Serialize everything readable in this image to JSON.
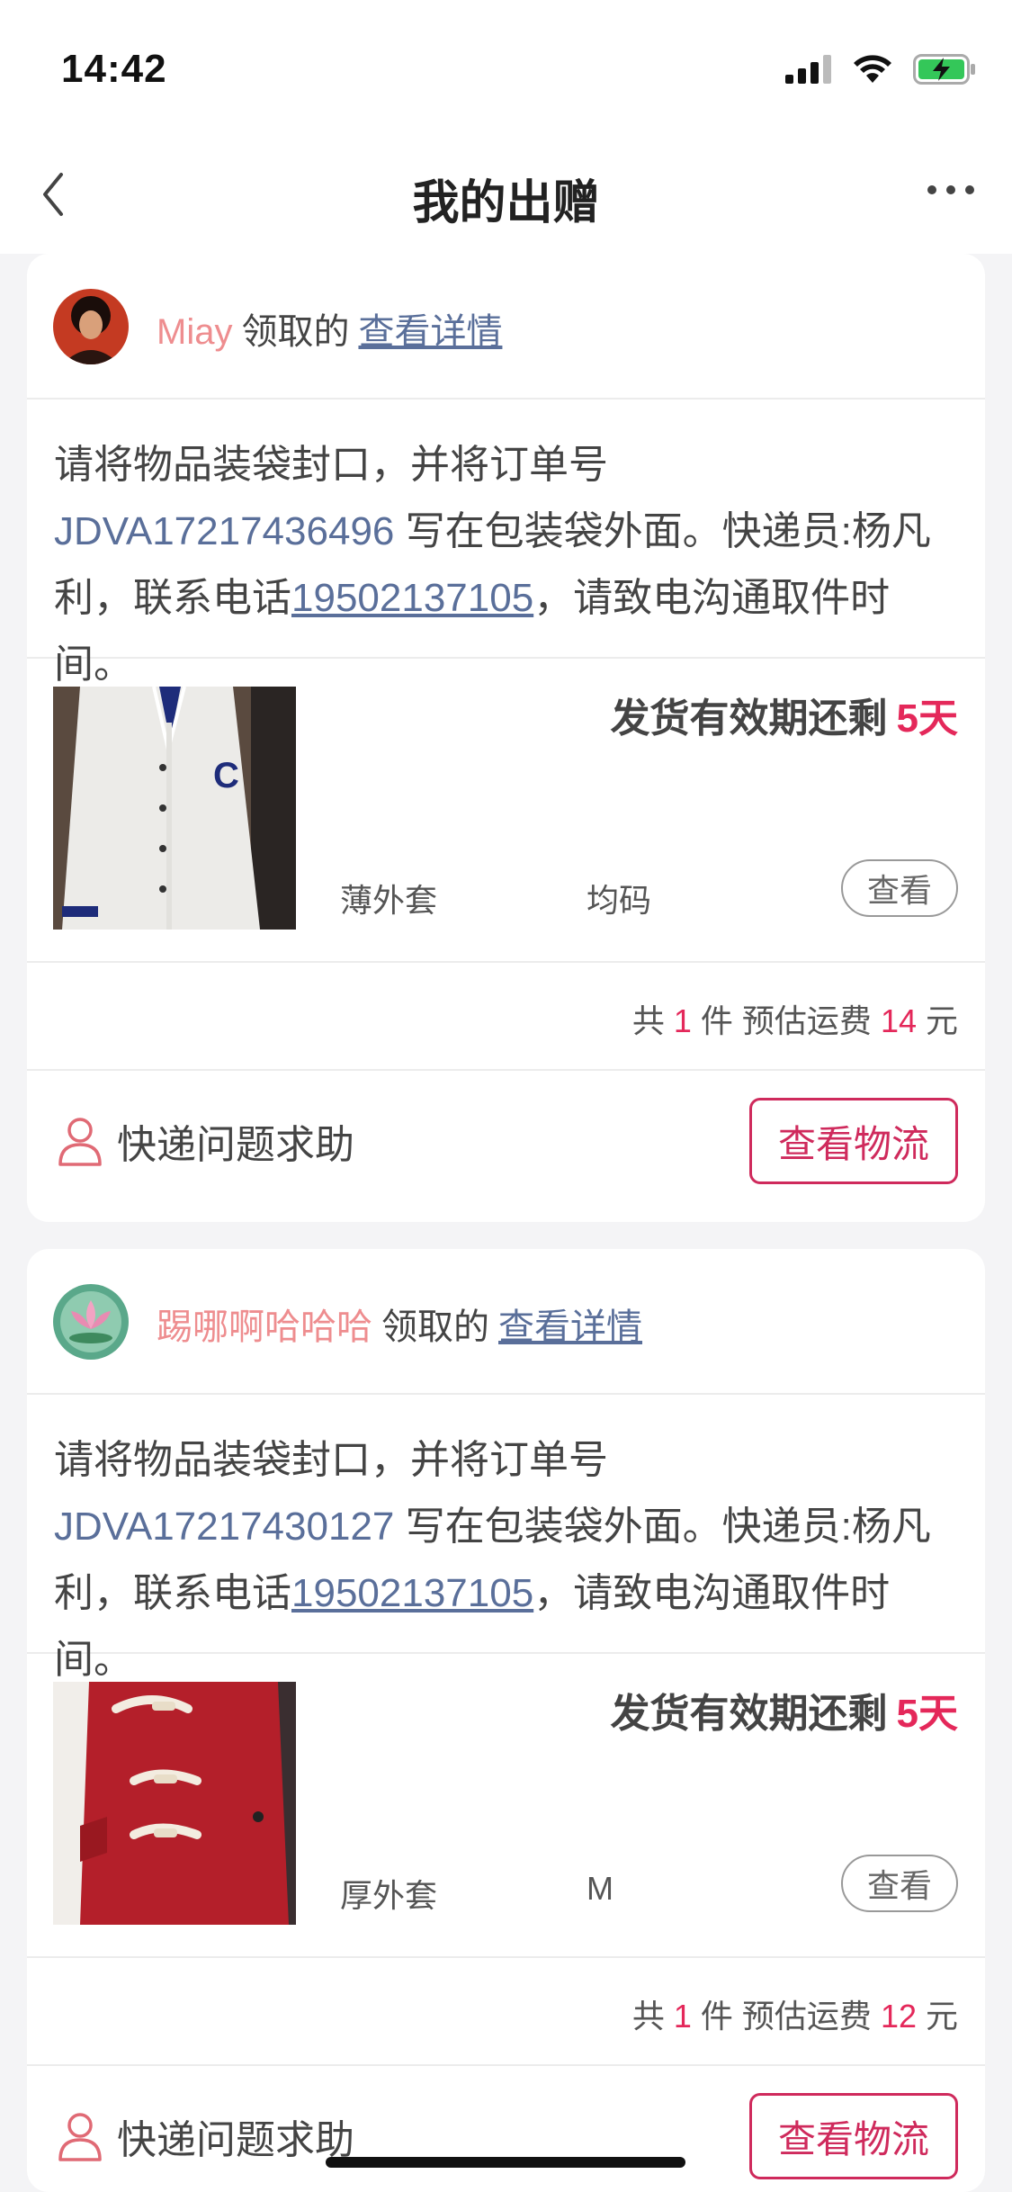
{
  "status_bar": {
    "time": "14:42"
  },
  "nav": {
    "title": "我的出赠"
  },
  "orders": [
    {
      "username": "Miay",
      "received_text": "领取的",
      "detail_link": "查看详情",
      "message_prefix": "请将物品装袋封口，并将订单号 ",
      "order_no": "JDVA17217436496",
      "message_mid": " 写在包装袋外面。快递员:杨凡利，联系电话",
      "phone": "19502137105",
      "message_suffix": "，请致电沟通取件时间。",
      "deadline_label": "发货有效期还剩",
      "deadline_days": "5天",
      "item_type": "薄外套",
      "item_size": "均码",
      "view_label": "查看",
      "summary_total_prefix": "共",
      "summary_count": "1",
      "summary_count_unit": "件 预估运费",
      "summary_fee": "14",
      "summary_fee_unit": "元",
      "help_label": "快递问题求助",
      "logistics_label": "查看物流"
    },
    {
      "username": "踢哪啊哈哈哈",
      "received_text": "领取的",
      "detail_link": "查看详情",
      "message_prefix": "请将物品装袋封口，并将订单号 ",
      "order_no": "JDVA17217430127",
      "message_mid": " 写在包装袋外面。快递员:杨凡利，联系电话",
      "phone": "19502137105",
      "message_suffix": "，请致电沟通取件时间。",
      "deadline_label": "发货有效期还剩",
      "deadline_days": "5天",
      "item_type": "厚外套",
      "item_size": "M",
      "view_label": "查看",
      "summary_total_prefix": "共",
      "summary_count": "1",
      "summary_count_unit": "件 预估运费",
      "summary_fee": "12",
      "summary_fee_unit": "元",
      "help_label": "快递问题求助",
      "logistics_label": "查看物流"
    }
  ],
  "colors": {
    "accent": "#e4285a",
    "link": "#5a6f9a",
    "username": "#ee8d8f",
    "button_border": "#cf2a5c"
  },
  "icons": [
    "back-chevron-icon",
    "more-dots-icon",
    "signal-icon",
    "wifi-icon",
    "battery-charging-icon",
    "person-icon"
  ]
}
